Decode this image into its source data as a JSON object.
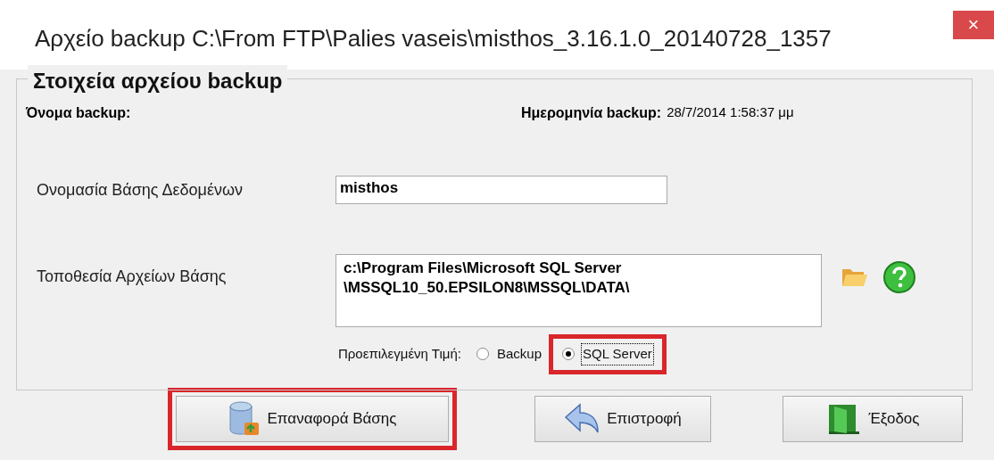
{
  "window": {
    "title": "Αρχείο backup C:\\From FTP\\Palies vaseis\\misthos_3.16.1.0_20140728_1357",
    "close": "×"
  },
  "group": {
    "title": "Στοιχεία αρχείου backup",
    "backup_name_label": "Όνομα backup:",
    "backup_date_label": "Ημερομηνία backup:",
    "backup_date_value": "28/7/2014 1:58:37 μμ",
    "db_name_label": "Ονομασία Βάσης Δεδομένων",
    "db_name_value": "misthos",
    "location_label": "Τοποθεσία Αρχείων Βάσης",
    "location_value": "c:\\Program Files\\Microsoft SQL Server\n\\MSSQL10_50.EPSILON8\\MSSQL\\DATA\\",
    "default_label": "Προεπιλεγμένη Τιμή:",
    "default_options": [
      {
        "label": "Backup",
        "selected": false,
        "highlighted": false
      },
      {
        "label": "SQL Server",
        "selected": true,
        "highlighted": true
      }
    ]
  },
  "buttons": [
    {
      "kind": "restore",
      "label": "Επαναφορά Βάσης",
      "highlighted": true
    },
    {
      "kind": "back",
      "label": "Επιστροφή",
      "highlighted": false
    },
    {
      "kind": "exit",
      "label": "Έξοδος",
      "highlighted": false
    }
  ]
}
